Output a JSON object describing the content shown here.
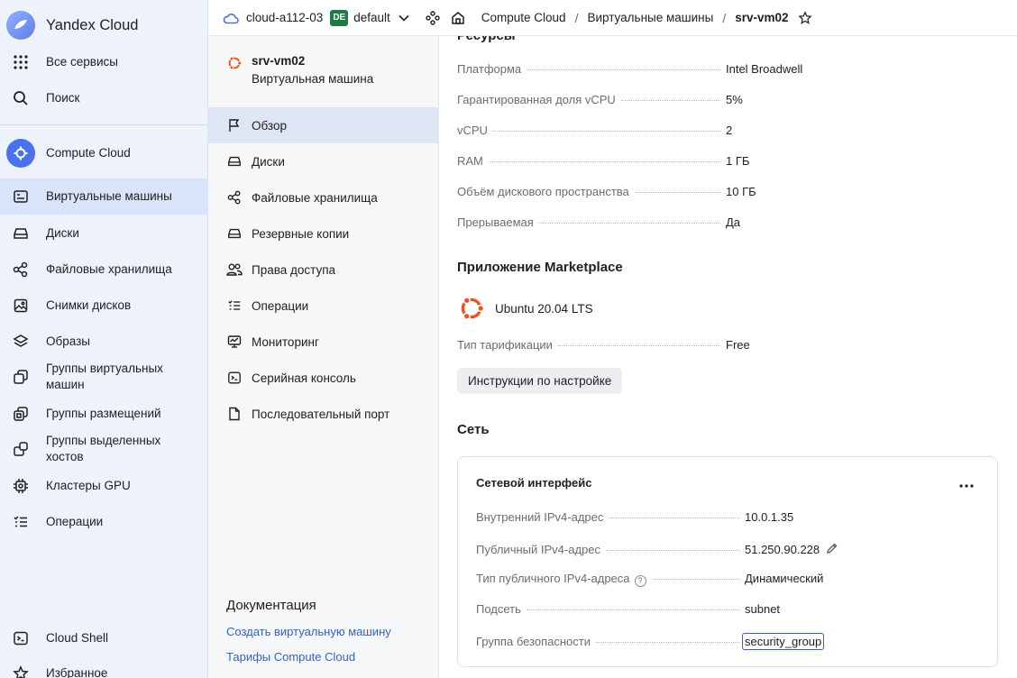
{
  "brand": {
    "name": "Yandex Cloud"
  },
  "gnav": {
    "all_services": "Все сервисы",
    "search": "Поиск",
    "service": "Compute Cloud",
    "items": [
      {
        "label": "Виртуальные машины"
      },
      {
        "label": "Диски"
      },
      {
        "label": "Файловые хранилища"
      },
      {
        "label": "Снимки дисков"
      },
      {
        "label": "Образы"
      },
      {
        "label": "Группы виртуальных\nмашин"
      },
      {
        "label": "Группы размещений"
      },
      {
        "label": "Группы выделенных\nхостов"
      },
      {
        "label": "Кластеры GPU"
      },
      {
        "label": "Операции"
      }
    ],
    "cloud_shell": "Cloud Shell",
    "favorites": "Избранное"
  },
  "topbar": {
    "cloud": "cloud-a112-03",
    "folder_badge": "DE",
    "folder": "default",
    "breadcrumb": [
      "Compute Cloud",
      "Виртуальные машины",
      "srv-vm02"
    ]
  },
  "vm": {
    "name": "srv-vm02",
    "type": "Виртуальная машина"
  },
  "snav": {
    "items": [
      {
        "label": "Обзор"
      },
      {
        "label": "Диски"
      },
      {
        "label": "Файловые хранилища"
      },
      {
        "label": "Резервные копии"
      },
      {
        "label": "Права доступа"
      },
      {
        "label": "Операции"
      },
      {
        "label": "Мониторинг"
      },
      {
        "label": "Серийная консоль"
      },
      {
        "label": "Последовательный порт"
      }
    ],
    "docs_title": "Документация",
    "docs_links": [
      "Создать виртуальную машину",
      "Тарифы Compute Cloud"
    ]
  },
  "resources": {
    "title": "Ресурсы",
    "rows": [
      {
        "k": "Платформа",
        "v": "Intel Broadwell"
      },
      {
        "k": "Гарантированная доля vCPU",
        "v": "5%"
      },
      {
        "k": "vCPU",
        "v": "2"
      },
      {
        "k": "RAM",
        "v": "1 ГБ"
      },
      {
        "k": "Объём дискового пространства",
        "v": "10 ГБ"
      },
      {
        "k": "Прерываемая",
        "v": "Да"
      }
    ]
  },
  "marketplace": {
    "title": "Приложение Marketplace",
    "product": "Ubuntu 20.04 LTS",
    "tariff_k": "Тип тарификации",
    "tariff_v": "Free",
    "button": "Инструкции по настройке"
  },
  "network": {
    "title": "Сеть",
    "card_title": "Сетевой интерфейс",
    "rows": [
      {
        "k": "Внутренний IPv4-адрес",
        "v": "10.0.1.35"
      },
      {
        "k": "Публичный IPv4-адрес",
        "v": "51.250.90.228"
      },
      {
        "k": "Тип публичного IPv4-адреса",
        "v": "Динамический"
      },
      {
        "k": "Подсеть",
        "v": "subnet"
      },
      {
        "k": "Группа безопасности",
        "v": "security_group"
      }
    ]
  },
  "colors": {
    "accent": "#3362c8",
    "active_bg": "#d9e3f9",
    "ubuntu": "#e95420",
    "badge": "#1e7b43"
  }
}
